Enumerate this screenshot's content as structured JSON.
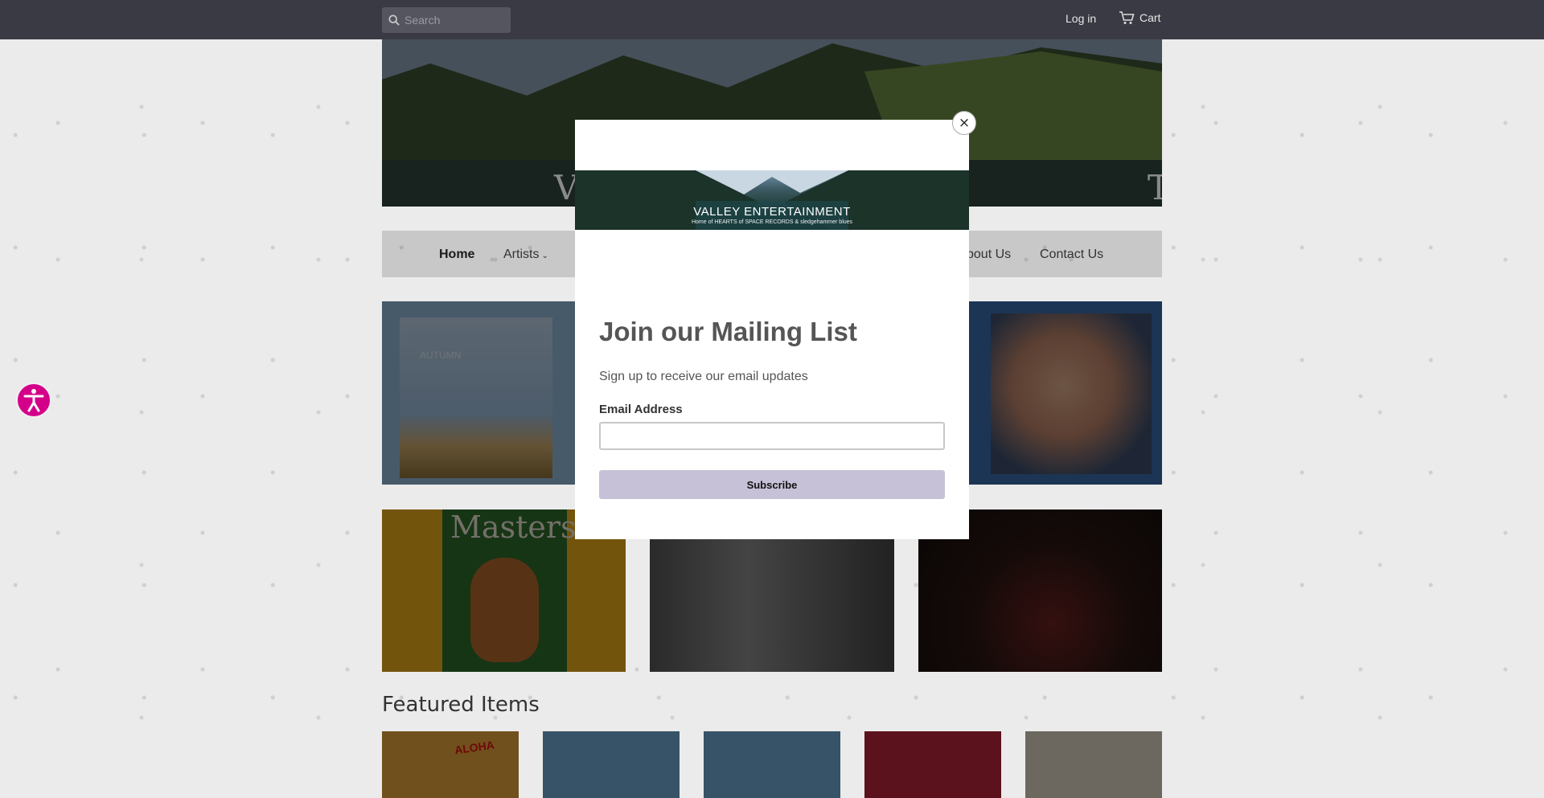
{
  "topbar": {
    "search_placeholder": "Search",
    "login_label": "Log in",
    "cart_label": "Cart"
  },
  "hero": {
    "overlay_letters": "V                                                     T"
  },
  "nav": {
    "items": [
      {
        "label": "Home"
      },
      {
        "label": "Artists"
      },
      {
        "label": "bout Us"
      },
      {
        "label": "Contact Us"
      }
    ]
  },
  "featured": {
    "title": "Featured Items"
  },
  "modal": {
    "brand": "VALLEY ENTERTAINMENT",
    "tagline": "Home of HEARTS of SPACE RECORDS & sledgehammer blues",
    "title": "Join our Mailing List",
    "subtitle": "Sign up to receive our email updates",
    "email_label": "Email Address",
    "email_value": "",
    "subscribe_label": "Subscribe",
    "close_symbol": "×"
  },
  "tiles": {
    "autumn_title": "AUTUMN",
    "masters_title": "Masters"
  },
  "products": {
    "aloha_text": "ALOHA"
  },
  "colors": {
    "topbar": "#3a3a44",
    "accessibility": "#d4008a",
    "subscribe": "#c6c1d6"
  }
}
